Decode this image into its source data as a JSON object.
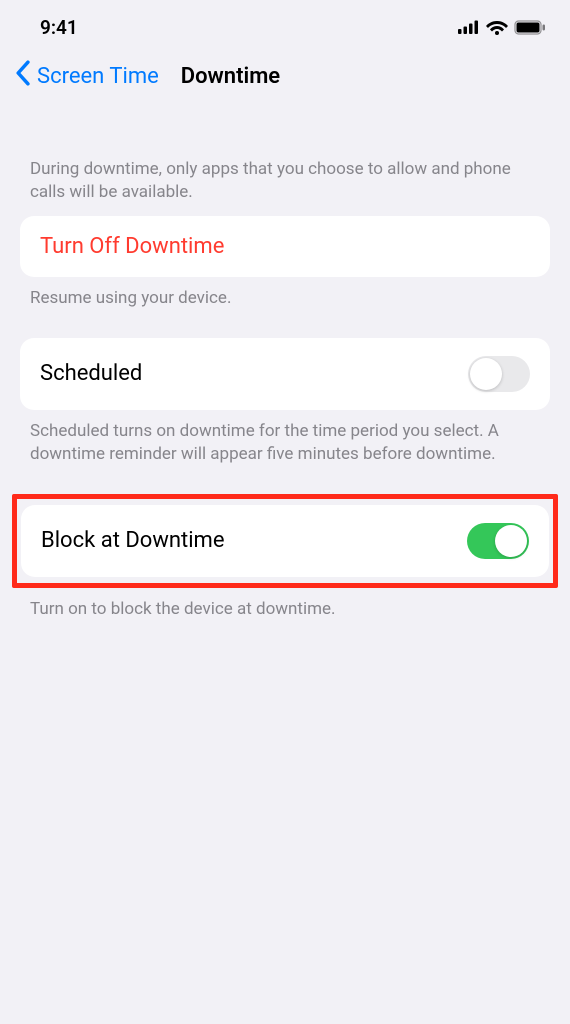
{
  "status": {
    "time": "9:41"
  },
  "nav": {
    "back_label": "Screen Time",
    "title": "Downtime"
  },
  "intro_desc": "During downtime, only apps that you choose to allow and phone calls will be available.",
  "turn_off": {
    "label": "Turn Off Downtime",
    "sub": "Resume using your device."
  },
  "scheduled": {
    "label": "Scheduled",
    "on": false,
    "sub": "Scheduled turns on downtime for the time period you select. A downtime reminder will appear five minutes before downtime."
  },
  "block": {
    "label": "Block at Downtime",
    "on": true,
    "sub": "Turn on to block the device at downtime."
  }
}
